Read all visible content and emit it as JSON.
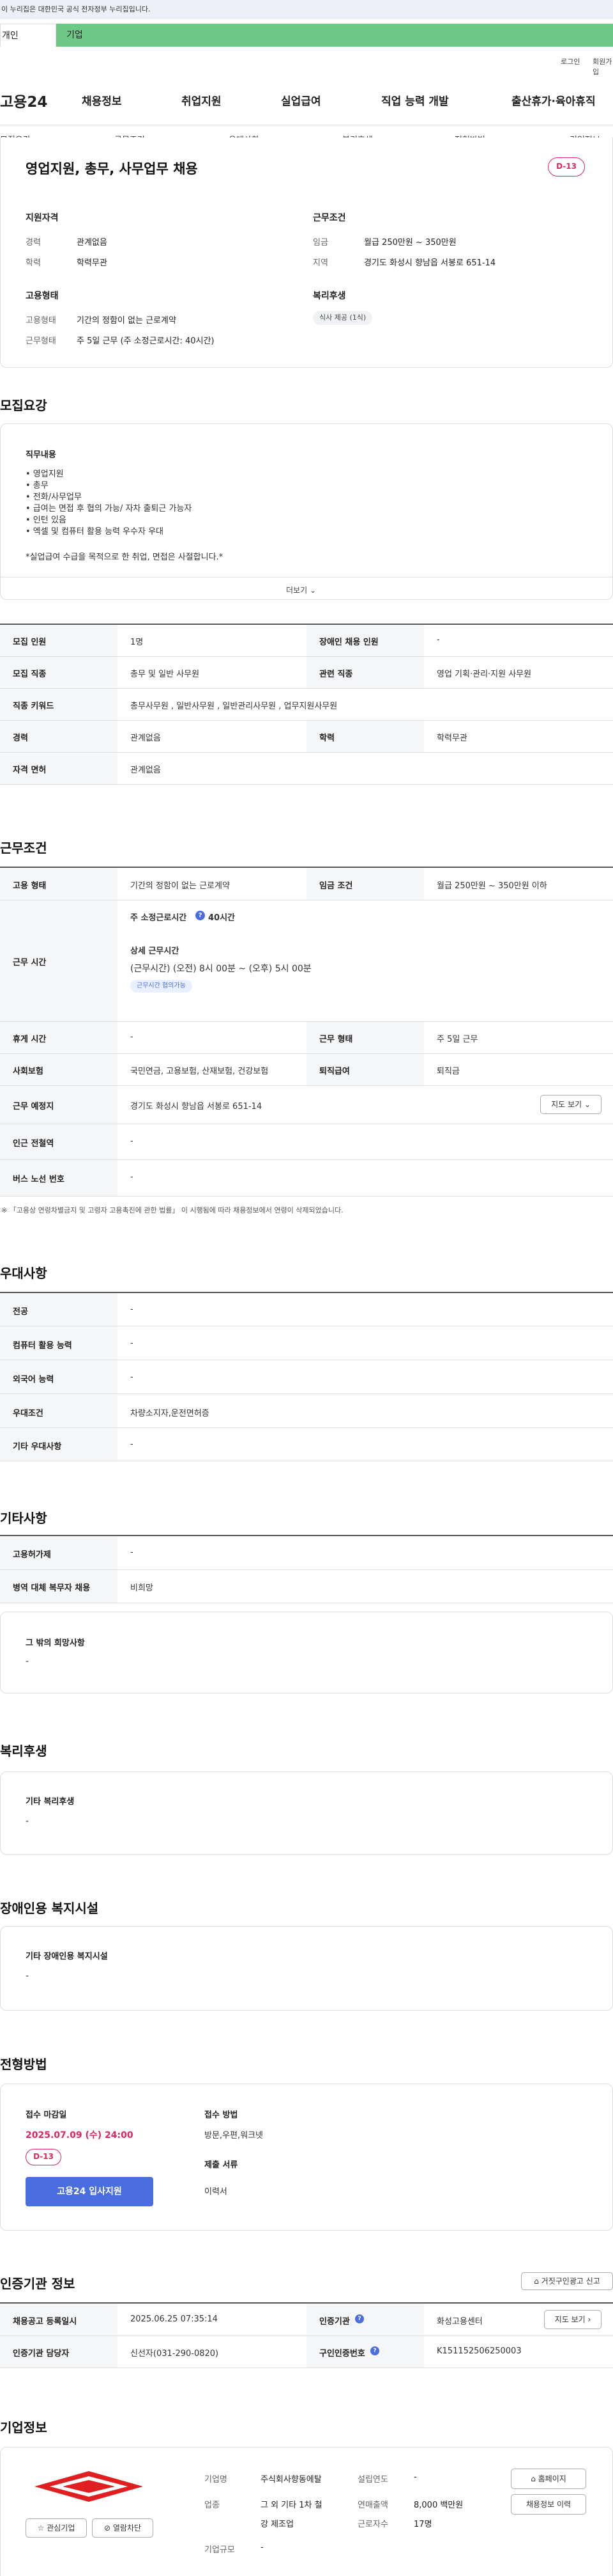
{
  "topbar": {
    "notice": "이 누리집은 대한민국 공식 전자정부 누리집입니다."
  },
  "tabs": {
    "individual": "개인",
    "business": "기업"
  },
  "util": {
    "login": "로그인",
    "signup": "회원가입"
  },
  "brand": {
    "logo": "고용24"
  },
  "gnb": [
    "채용정보",
    "취업지원",
    "실업급여",
    "직업 능력 개발",
    "출산휴가·육아휴직"
  ],
  "subnav": [
    "모집요강",
    "근무조건",
    "우대사항",
    "복리후생",
    "전형방법",
    "기업정보"
  ],
  "summary": {
    "title": "영업지원, 총무, 사무업무 채용",
    "dday": "D-13",
    "qual_title": "지원자격",
    "career_k": "경력",
    "career_v": "관계없음",
    "edu_k": "학력",
    "edu_v": "학력무관",
    "cond_title": "근무조건",
    "wage_k": "임금",
    "wage_v": "월급 250만원 ~ 350만원",
    "region_k": "지역",
    "region_v": "경기도 화성시 향남읍 서봉로 651-14",
    "emp_title": "고용형태",
    "type_k": "고용형태",
    "type_v": "기간의 정함이 없는 근로계약",
    "work_k": "근무형태",
    "work_v": "주 5일 근무 (주 소정근로시간: 40시간)",
    "welfare_title": "복리후생",
    "welfare_chip": "식사 제공 (1식)"
  },
  "recruit": {
    "section": "모집요강",
    "duty_title": "직무내용",
    "duty_lines": [
      "• 영업지원",
      "• 총무",
      "• 전화/사무업무",
      "• 급여는 면접 후 협의 가능/ 자차 출퇴근 가능자",
      "• 인턴 있음",
      "• 엑셀 및 컴퓨터 활용 능력 우수자 우대"
    ],
    "duty_note": "*실업급여 수급을 목적으로 한 취업, 면접은 사절합니다.*",
    "more": "더보기",
    "rows": [
      {
        "k1": "모집 인원",
        "v1": "1명",
        "k2": "장애인 채용 인원",
        "v2": "-"
      },
      {
        "k1": "모집 직종",
        "v1": "총무 및 일반 사무원",
        "k2": "관련 직종",
        "v2": "영업 기획·관리·지원 사무원"
      },
      {
        "k1": "직종 키워드",
        "v1": "총무사무원 , 일반사무원 , 일반관리사무원 , 업무지원사무원"
      },
      {
        "k1": "경력",
        "v1": "관계없음",
        "k2": "학력",
        "v2": "학력무관"
      },
      {
        "k1": "자격 면허",
        "v1": "관계없음"
      }
    ]
  },
  "conditions": {
    "section": "근무조건",
    "emp_k": "고용 형태",
    "emp_v": "기간의 정함이 없는 근로계약",
    "wage_k": "임금 조건",
    "wage_v": "월급 250만원 ~ 350만원 이하",
    "hours_k": "근무 시간",
    "hours_title": "주 소정근로시간",
    "hours_value": "40시간",
    "detail_title": "상세 근무시간",
    "detail_value": "(근무시간) (오전) 8시 00분 ~ (오후) 5시 00분",
    "flex_chip": "근무시간 협의가능",
    "rest_k": "휴게 시간",
    "rest_v": "-",
    "form_k": "근무 형태",
    "form_v": "주 5일 근무",
    "ins_k": "사회보험",
    "ins_v": "국민연금, 고용보험, 산재보험, 건강보험",
    "ret_k": "퇴직급여",
    "ret_v": "퇴직금",
    "place_k": "근무 예정지",
    "place_v": "경기도 화성시 향남읍 서봉로 651-14",
    "map_btn": "지도 보기",
    "station_k": "인근 전철역",
    "station_v": "-",
    "bus_k": "버스 노선 번호",
    "bus_v": "-",
    "footnote": "※ 「고용상 연령차별금지 및 고령자 고용촉진에 관한 법률」 이 시행됨에 따라 채용정보에서 연령이 삭제되었습니다."
  },
  "pref": {
    "section": "우대사항",
    "rows": [
      {
        "k": "전공",
        "v": "-"
      },
      {
        "k": "컴퓨터 활용 능력",
        "v": "-"
      },
      {
        "k": "외국어 능력",
        "v": "-"
      },
      {
        "k": "우대조건",
        "v": "차량소지자,운전면허증"
      },
      {
        "k": "기타 우대사항",
        "v": "-"
      }
    ]
  },
  "etc": {
    "section": "기타사항",
    "rows": [
      {
        "k": "고용허가제",
        "v": "-"
      },
      {
        "k": "병역 대체 복무자 채용",
        "v": "비희망"
      }
    ],
    "box_title": "그 밖의 희망사항",
    "box_value": "-"
  },
  "welfare": {
    "section": "복리후생",
    "box_title": "기타 복리후생",
    "box_value": "-"
  },
  "disabled": {
    "section": "장애인용 복지시설",
    "box_title": "기타 장애인용 복지시설",
    "box_value": "-"
  },
  "process": {
    "section": "전형방법",
    "deadline_title": "접수 마감일",
    "deadline": "2025.07.09 (수) 24:00",
    "dday": "D-13",
    "apply_btn": "고용24 입사지원",
    "method_title": "접수 방법",
    "method": "방문,우편,워크넷",
    "docs_title": "제출 서류",
    "docs": "이력서"
  },
  "agency": {
    "section": "인증기관 정보",
    "report_btn": "거짓구인광고 신고",
    "reg_k": "채용공고 등록일시",
    "reg_v": "2025.06.25 07:35:14",
    "org_k": "인증기관",
    "org_v": "화성고용센터",
    "map_btn": "지도 보기",
    "staff_k": "인증기관 담당자",
    "staff_v": "신선자(031-290-0820)",
    "id_k": "구인인증번호",
    "id_v": "K151152506250003"
  },
  "company": {
    "section": "기업정보",
    "name_k": "기업명",
    "name_v": "주식회사향동에탈",
    "ind_k": "업종",
    "ind_v1": "그 외 기타 1차 철",
    "ind_v2": "강 제조업",
    "size_k": "기업규모",
    "size_v": "-",
    "year_k": "설립연도",
    "year_v": "-",
    "sales_k": "연매출액",
    "sales_v": "8,000 백만원",
    "emp_k": "근로자수",
    "emp_v": "17명",
    "home_btn": "홈페이지",
    "hist_btn": "채용정보 이력",
    "fav_btn": "관심기업",
    "block_btn": "열람차단"
  },
  "colors": {
    "accent": "#4a6ee0",
    "dday": "#e0245e",
    "tab": "#6ec987",
    "logo": "#e02020"
  }
}
